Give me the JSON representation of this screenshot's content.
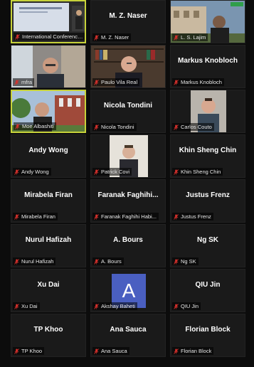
{
  "participants": [
    {
      "label": "International Conference...",
      "center": "",
      "video": "slides",
      "active": true
    },
    {
      "label": "M. Z. Naser",
      "center": "M. Z. Naser",
      "video": ""
    },
    {
      "label": "L. S. Lajim",
      "center": "",
      "video": "outdoor"
    },
    {
      "label": "mfra",
      "center": "",
      "video": "man-glasses"
    },
    {
      "label": "Paulo Vila Real",
      "center": "",
      "video": "bookshelf"
    },
    {
      "label": "Markus Knobloch",
      "center": "Markus Knobloch",
      "video": ""
    },
    {
      "label": "Moe Albashiti",
      "center": "",
      "video": "campus",
      "active": true
    },
    {
      "label": "Nicola Tondini",
      "center": "Nicola Tondini",
      "video": ""
    },
    {
      "label": "Carlos Couto",
      "center": "",
      "video": "young-man"
    },
    {
      "label": "Andy Wong",
      "center": "Andy Wong",
      "video": ""
    },
    {
      "label": "Patrick Covi",
      "center": "",
      "video": "white-room"
    },
    {
      "label": "Khin Sheng Chin",
      "center": "Khin Sheng Chin",
      "video": ""
    },
    {
      "label": "Mirabela Firan",
      "center": "Mirabela Firan",
      "video": ""
    },
    {
      "label": "Faranak Faghihi Habi...",
      "center": "Faranak  Faghihi...",
      "video": ""
    },
    {
      "label": "Justus Frenz",
      "center": "Justus Frenz",
      "video": ""
    },
    {
      "label": "Nurul Hafizah",
      "center": "Nurul Hafizah",
      "video": ""
    },
    {
      "label": "A. Bours",
      "center": "A. Bours",
      "video": ""
    },
    {
      "label": "Ng SK",
      "center": "Ng SK",
      "video": ""
    },
    {
      "label": "Xu Dai",
      "center": "Xu Dai",
      "video": ""
    },
    {
      "label": "Akshay Baheti",
      "center": "",
      "video": "avatar",
      "avatar_letter": "A"
    },
    {
      "label": "QIU Jin",
      "center": "QIU Jin",
      "video": ""
    },
    {
      "label": "TP Khoo",
      "center": "TP Khoo",
      "video": ""
    },
    {
      "label": "Ana Sauca",
      "center": "Ana Sauca",
      "video": ""
    },
    {
      "label": "Florian Block",
      "center": "Florian Block",
      "video": ""
    }
  ],
  "colors": {
    "active_border": "#c7d23a",
    "muted_mic": "#d9302c",
    "avatar_bg": "#4a5fc1"
  },
  "icons": {
    "muted": "microphone-muted-icon"
  }
}
